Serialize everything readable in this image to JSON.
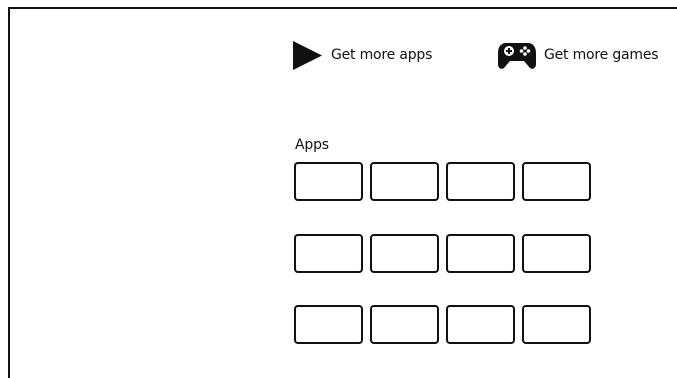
{
  "header": {
    "get_more_apps": {
      "label": "Get more apps",
      "icon": "play-triangle-icon"
    },
    "get_more_games": {
      "label": "Get more games",
      "icon": "gamepad-icon"
    }
  },
  "apps": {
    "title": "Apps",
    "rows": [
      [
        "",
        "",
        "",
        ""
      ],
      [
        "",
        "",
        "",
        ""
      ],
      [
        "",
        "",
        "",
        ""
      ]
    ]
  },
  "colors": {
    "foreground": "#111111",
    "background": "#ffffff"
  }
}
